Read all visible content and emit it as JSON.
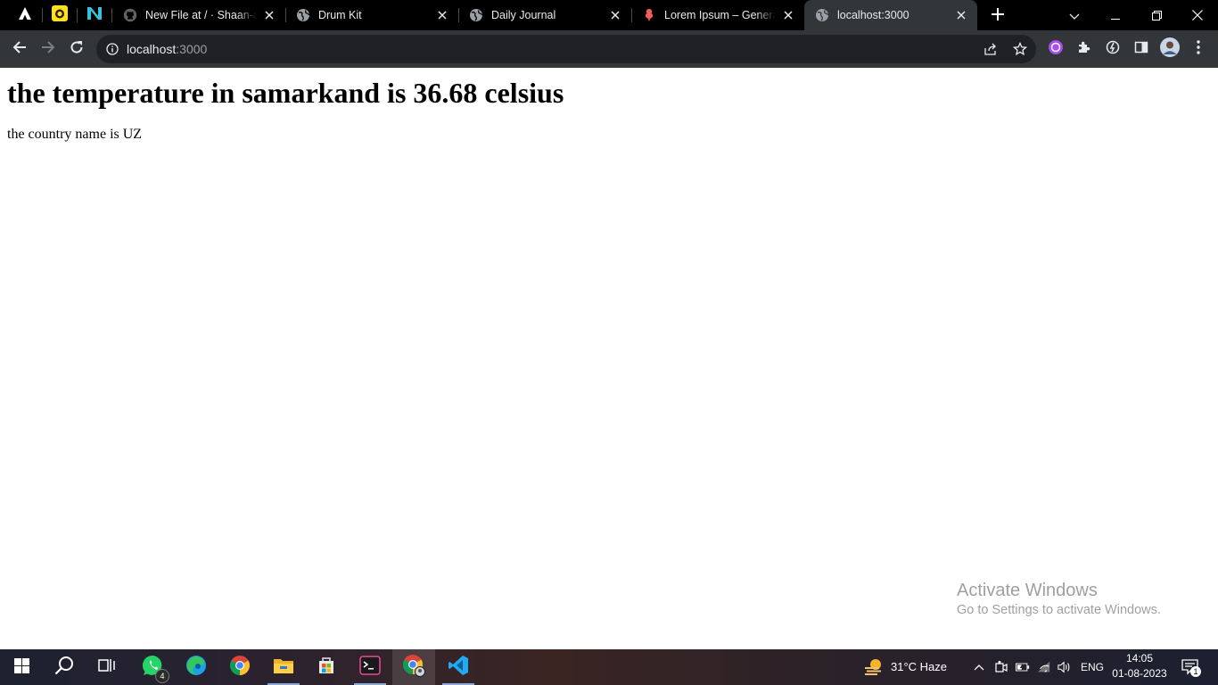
{
  "browser": {
    "tabs": [
      {
        "title": "New File at / · Shaan-akh",
        "icon": "github-icon"
      },
      {
        "title": "Drum Kit",
        "icon": "globe-icon"
      },
      {
        "title": "Daily Journal",
        "icon": "globe-icon"
      },
      {
        "title": "Lorem Ipsum – Generato",
        "icon": "lorem-ipsum-icon"
      },
      {
        "title": "localhost:3000",
        "icon": "globe-icon",
        "active": true
      }
    ],
    "pinned_tabs": [
      "arch-icon",
      "mailchimp-icon",
      "n-logo-icon"
    ],
    "address_bar": {
      "host": "localhost",
      "port": ":3000"
    }
  },
  "page": {
    "heading": "the temperature in samarkand is 36.68 celsius",
    "country_text": "the country name is UZ"
  },
  "watermark": {
    "title": "Activate Windows",
    "subtitle": "Go to Settings to activate Windows."
  },
  "taskbar": {
    "apps": [
      "windows-start-icon",
      "search-icon",
      "task-view-icon",
      "whatsapp-icon",
      "edge-icon",
      "chrome-icon",
      "file-explorer-icon",
      "microsoft-store-icon",
      "terminal-icon",
      "chrome-profile-icon",
      "vscode-icon"
    ],
    "whatsapp_badge": "4",
    "weather": "31°C  Haze",
    "language": "ENG",
    "time": "14:05",
    "date": "01-08-2023",
    "notification_count": "1"
  },
  "colors": {
    "tabstrip_bg": "#000000",
    "toolbar_bg": "#323639",
    "omnibox_bg": "#202124",
    "accent": "#76b9ed"
  }
}
